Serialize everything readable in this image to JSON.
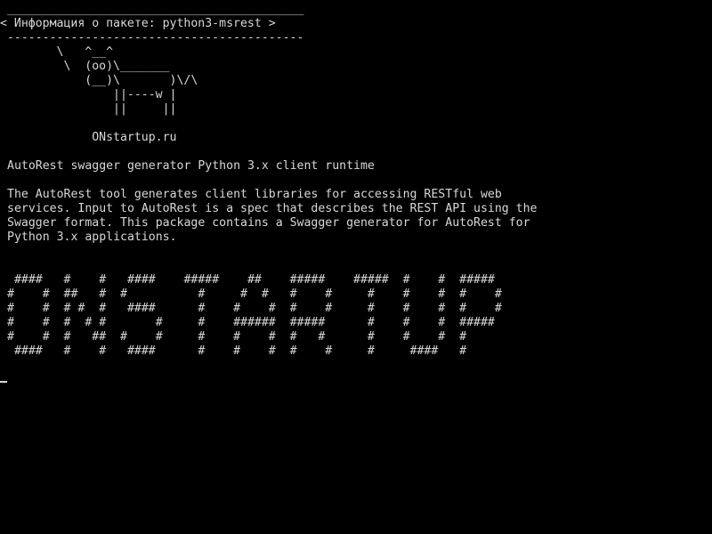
{
  "terminal": {
    "fg_color": "#d8d8d8",
    "bg_color": "#000000",
    "bubble": {
      "border_top": " __________________________________________",
      "text": "< Информация о пакете: python3-msrest >",
      "border_bottom": " ------------------------------------------"
    },
    "cow": [
      "        \\   ^__^",
      "         \\  (oo)\\_______",
      "            (__)\\       )\\/\\",
      "                ||----w |",
      "                ||     ||"
    ],
    "site": "             ONstartup.ru",
    "summary": "AutoRest swagger generator Python 3.x client runtime",
    "description": [
      "The AutoRest tool generates client libraries for accessing RESTful web",
      "services. Input to AutoRest is a spec that describes the REST API using the",
      "Swagger format. This package contains a Swagger generator for AutoRest for",
      "Python 3.x applications."
    ],
    "banner": [
      " ####   #    #   ####    #####    ##    #####    #####  #    #  #####",
      "#    #  ##   #  #          #     #  #   #    #     #    #    #  #    #",
      "#    #  # #  #   ####      #    #    #  #    #     #    #    #  #    #",
      "#    #  #  # #       #     #    ######  #####      #    #    #  #####",
      "#    #  #   ##  #    #     #    #    #  #   #      #    #    #  #",
      " ####   #    #   ####      #    #    #  #    #     #     ####   #"
    ]
  }
}
